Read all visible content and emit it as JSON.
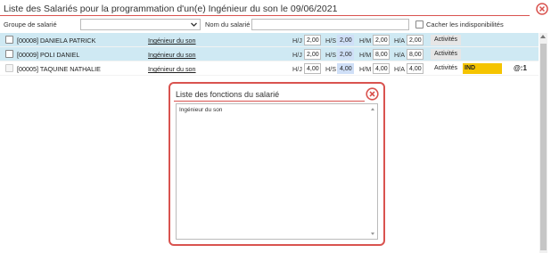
{
  "header": {
    "title": "Liste des Salariés pour la programmation d'un(e) Ingénieur du son le 09/06/2021",
    "close_icon": "close-circle-icon",
    "accent_color": "#d9534f"
  },
  "filters": {
    "group_label": "Groupe de salarié",
    "group_value": "",
    "name_label": "Nom du salarié :",
    "name_value": "",
    "hide_label": "Cacher les indisponibilités"
  },
  "rows": [
    {
      "name": "[00008] DANIELA PATRICK",
      "function": "Ingénieur du son",
      "hj_label": "H/J",
      "hj": "2,00",
      "hs_label": "H/S",
      "hs": "2,00",
      "hm_label": "H/M",
      "hm": "2,00",
      "ha_label": "H/A",
      "ha": "2,00",
      "activities": "Activités",
      "style": "blue"
    },
    {
      "name": "[00009] POLI DANIEL",
      "function": "Ingénieur du son",
      "hj_label": "H/J",
      "hj": "2,00",
      "hs_label": "H/S",
      "hs": "2,00",
      "hm_label": "H/M",
      "hm": "8,00",
      "ha_label": "H/A",
      "ha": "8,00",
      "activities": "Activités",
      "style": "blue"
    },
    {
      "name": "[00005] TAQUINE NATHALIE",
      "function": "Ingénieur du son",
      "hj_label": "H/J",
      "hj": "4,00",
      "hs_label": "H/S",
      "hs": "4,00",
      "hm_label": "H/M",
      "hm": "4,00",
      "ha_label": "H/A",
      "ha": "4,00",
      "activities": "Activités",
      "badge": "IND",
      "badge_color": "#f5c400",
      "at": "@:1",
      "style": "white"
    }
  ],
  "modal": {
    "title": "Liste des fonctions du salarié",
    "content": "Ingénieur du son",
    "close_icon": "close-circle-icon"
  }
}
